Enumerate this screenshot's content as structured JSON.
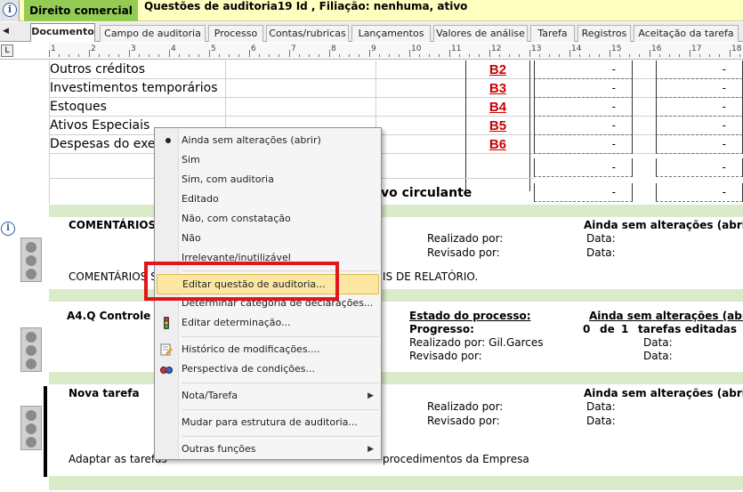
{
  "titlebar": {
    "label": "Direito comercial",
    "text": "Questões de auditoria19 Id , Filiação: nenhuma, ativo"
  },
  "tabs": [
    {
      "label": "Documento",
      "active": true
    },
    {
      "label": "Campo de auditoria"
    },
    {
      "label": "Processo"
    },
    {
      "label": "Contas/rubricas"
    },
    {
      "label": "Lançamentos"
    },
    {
      "label": "Valores de análise"
    },
    {
      "label": "Tarefa"
    },
    {
      "label": "Registros"
    },
    {
      "label": "Aceitação da tarefa"
    }
  ],
  "ruler": {
    "numbers": [
      "1",
      "2",
      "3",
      "4",
      "5",
      "6",
      "7",
      "8",
      "9",
      "10",
      "11",
      "12",
      "13",
      "14",
      "15",
      "16",
      "17",
      "18"
    ]
  },
  "document": {
    "rows": [
      {
        "label": "Outros créditos",
        "ref": "B2",
        "v1": "-",
        "v2": "-"
      },
      {
        "label": "Investimentos temporários",
        "ref": "B3",
        "v1": "-",
        "v2": "-"
      },
      {
        "label": "Estoques",
        "ref": "B4",
        "v1": "-",
        "v2": "-"
      },
      {
        "label": "Ativos Especiais",
        "ref": "B5",
        "v1": "-",
        "v2": "-"
      },
      {
        "label": "Despesas do exe",
        "ref": "B6",
        "v1": "-",
        "v2": "-"
      }
    ],
    "total_row": {
      "v1": "-",
      "v2": "-"
    },
    "total2_row": {
      "label": "vo circulante",
      "v1": "-",
      "v2": "-"
    },
    "section1": {
      "title": "COMENTÁRIOS",
      "status": "Ainda sem alterações (abrir)",
      "realized": "Realizado por:",
      "reviewed": "Revisado por:",
      "date1": "Data:",
      "date2": "Data:",
      "body_left": "COMENTÁRIOS S",
      "body_right": "IS DE RELATÓRIO."
    },
    "section2": {
      "title": "A4.Q Controle de",
      "process_label": "Estado do processo:",
      "status": "Ainda sem alterações (abrir)",
      "progress_label": "Progresso:",
      "progress_done": "0",
      "progress_of": "de",
      "progress_total": "1",
      "progress_suffix": "tarefas editadas",
      "realized": "Realizado por: Gil.Garces",
      "reviewed": "Revisado por:",
      "date1": "Data:",
      "date2": "Data:"
    },
    "section3": {
      "title": "Nova tarefa",
      "status": "Ainda sem alterações (abrir)",
      "realized": "Realizado por:",
      "reviewed": "Revisado por:",
      "date1": "Data:",
      "date2": "Data:",
      "body_left": "Adaptar as tarefas",
      "body_right": "procedimentos da Empresa"
    }
  },
  "context_menu": {
    "status_items": [
      "Ainda sem alterações (abrir)",
      "Sim",
      "Sim, com auditoria",
      "Editado",
      "Não, com constatação",
      "Não",
      "Irrelevante/inutilizável"
    ],
    "edit_question": "Editar questão de auditoria...",
    "determine_category": "Determinar categoria de declarações...",
    "edit_determination": "Editar determinação...",
    "history": "Histórico de modificações....",
    "conditions": "Perspectiva de condições...",
    "note_task": "Nota/Tarefa",
    "change_structure": "Mudar para estrutura de auditoria...",
    "other_functions": "Outras funções"
  },
  "colors": {
    "title_bg": "#ffffc0",
    "title_label_bg": "#94cc53",
    "ref_red": "#cc0000",
    "band_green": "#d9ebc8",
    "highlight_frame": "#e0161b",
    "menu_hover": "#fbe7a2"
  }
}
